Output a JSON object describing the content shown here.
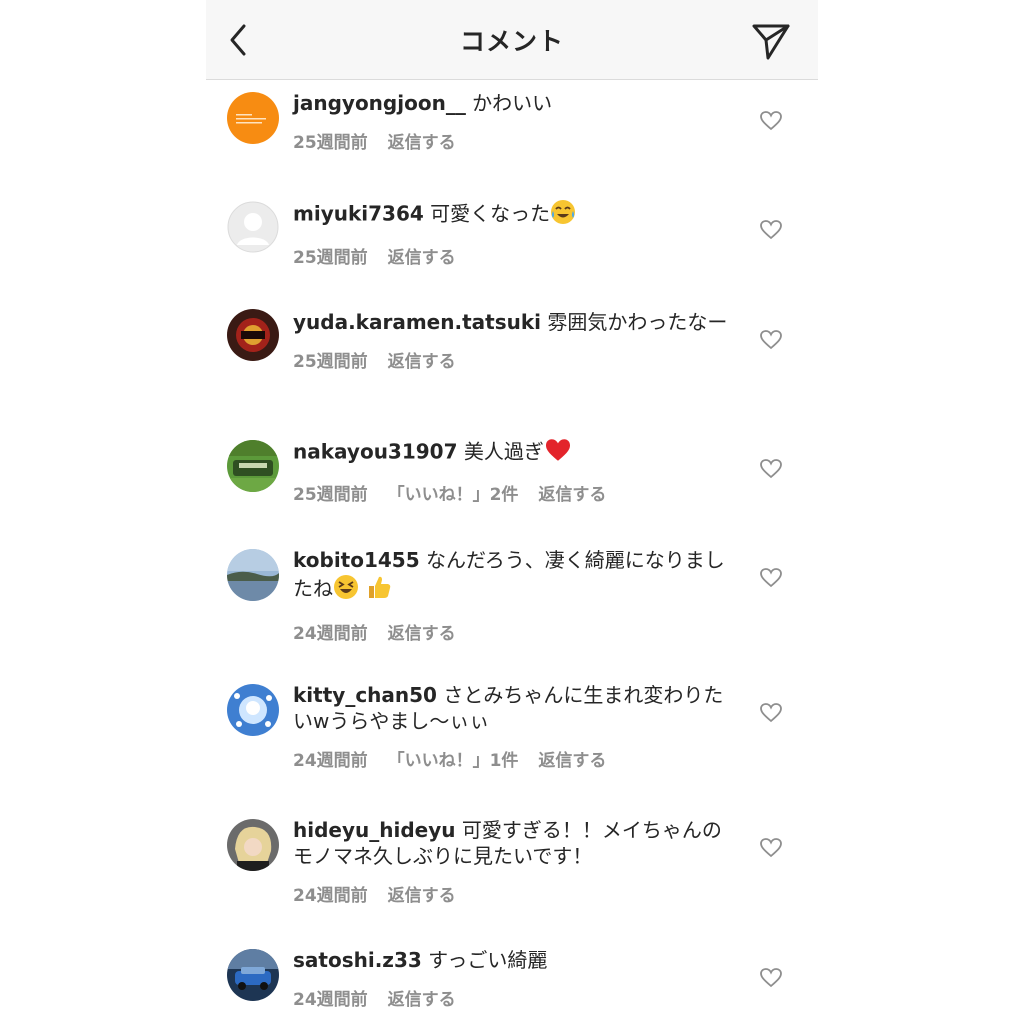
{
  "header": {
    "title": "コメント",
    "back_icon": "chevron-left-icon",
    "send_icon": "paper-plane-icon"
  },
  "comments": [
    {
      "username": "jangyongjoon__",
      "text": "かわいい",
      "time": "25週間前",
      "reply": "返信する"
    },
    {
      "username": "miyuki7364",
      "text": "可愛くなった",
      "emoji": "face-with-tears-of-joy-emoji",
      "time": "25週間前",
      "reply": "返信する"
    },
    {
      "username": "yuda.karamen.tatsuki",
      "text": "雰囲気かわったなー",
      "time": "25週間前",
      "reply": "返信する"
    },
    {
      "username": "nakayou31907",
      "text": "美人過ぎ",
      "emoji": "red-heart-emoji",
      "time": "25週間前",
      "likes": "「いいね！」2件",
      "reply": "返信する"
    },
    {
      "username": "kobito1455",
      "text": "なんだろう、凄く綺麗になりましたね",
      "emoji": "grinning-squinting-face-emoji thumbs-up-emoji",
      "time": "24週間前",
      "reply": "返信する"
    },
    {
      "username": "kitty_chan50",
      "text": "さとみちゃんに生まれ変わりたいwうらやまし〜ぃぃ",
      "time": "24週間前",
      "likes": "「いいね！」1件",
      "reply": "返信する"
    },
    {
      "username": "hideyu_hideyu",
      "text": "可愛すぎる！！メイちゃんのモノマネ久しぶりに見たいです！",
      "time": "24週間前",
      "reply": "返信する"
    },
    {
      "username": "satoshi.z33",
      "text": "すっごい綺麗",
      "time": "24週間前",
      "reply": "返信する"
    }
  ],
  "colors": {
    "text": "#262626",
    "meta": "#8e8e8e",
    "header_bg": "#f7f7f7"
  }
}
